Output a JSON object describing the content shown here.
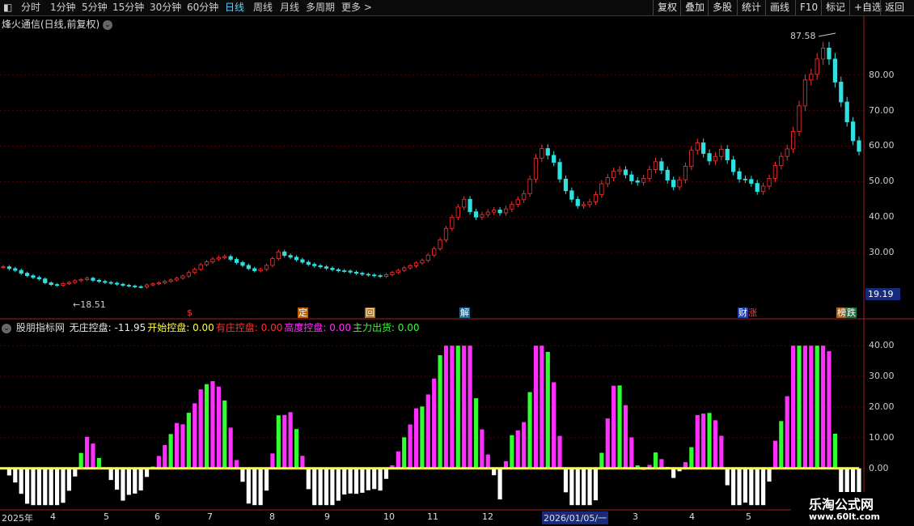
{
  "toolbar": {
    "periods": [
      "分时",
      "1分钟",
      "5分钟",
      "15分钟",
      "30分钟",
      "60分钟",
      "日线",
      "周线",
      "月线",
      "多周期",
      "更多 >"
    ],
    "active": "日线",
    "actions": [
      "复权",
      "叠加",
      "多股",
      "统计",
      "画线",
      "F10",
      "标记",
      "+自选",
      "返回"
    ]
  },
  "main": {
    "title": "烽火通信(日线,前复权)",
    "peak_label": "87.58",
    "low_label": "18.51",
    "current_price": "19.19",
    "y_ticks": [
      "80.00",
      "70.00",
      "60.00",
      "50.00",
      "40.00",
      "30.00"
    ],
    "signals": [
      {
        "text": "$",
        "color": "#ff3030",
        "bg": "transparent"
      },
      {
        "text": "定",
        "color": "#ffffff",
        "bg": "#c06000"
      },
      {
        "text": "回",
        "color": "#ffffff",
        "bg": "#a07030"
      },
      {
        "text": "解",
        "color": "#ffffff",
        "bg": "#1a6a9a"
      },
      {
        "text": "财",
        "color": "#ffffff",
        "bg": "#2040a0"
      },
      {
        "text": "涨",
        "color": "#ff4040",
        "bg": "transparent"
      },
      {
        "text": "榜",
        "color": "#ffffff",
        "bg": "#a06020"
      },
      {
        "text": "跌",
        "color": "#ffffff",
        "bg": "#207040"
      }
    ]
  },
  "indicator": {
    "name": "股朋指标网",
    "items": [
      {
        "label": "无庄控盘: -11.95",
        "color": "#e8e8e8"
      },
      {
        "label": "开始控盘: 0.00",
        "color": "#ffff40"
      },
      {
        "label": "有庄控盘: 0.00",
        "color": "#ff3030"
      },
      {
        "label": "高度控盘: 0.00",
        "color": "#ff30ff"
      },
      {
        "label": "主力出货: 0.00",
        "color": "#30ff30"
      }
    ],
    "y_ticks": [
      "40.00",
      "30.00",
      "20.00",
      "10.00",
      "0.00"
    ]
  },
  "time_axis": [
    "2025年",
    "4",
    "5",
    "6",
    "7",
    "8",
    "9",
    "10",
    "11",
    "12",
    "2026/01/05/一",
    "3",
    "4",
    "5"
  ],
  "watermark": {
    "line1": "乐淘公式网",
    "line2": "www.60lt.com"
  },
  "colors": {
    "up": "#ff3030",
    "down": "#30e0e0",
    "grid": "#5a0000",
    "magenta": "#ff30ff",
    "green": "#30ff30",
    "yellow": "#ffff40",
    "white": "#ffffff"
  },
  "chart_data": {
    "type": "candlestick",
    "close_series": [
      26,
      25.5,
      25,
      24.2,
      23.5,
      23,
      22.6,
      21.5,
      21,
      20.8,
      21.3,
      21.6,
      22.1,
      22.4,
      22.8,
      22.2,
      21.9,
      21.6,
      21.4,
      21.1,
      20.8,
      20.6,
      20.4,
      20.3,
      20.9,
      21.2,
      21.5,
      21.9,
      22.3,
      22.8,
      23.4,
      24.4,
      25.3,
      26.6,
      27.4,
      28.2,
      28.6,
      28.9,
      28.1,
      27.2,
      26.4,
      25.5,
      24.9,
      25.3,
      26.4,
      28.3,
      30.2,
      29.2,
      28.7,
      28,
      27.3,
      26.7,
      26.3,
      26,
      25.6,
      25.2,
      24.9,
      24.8,
      24.5,
      24.2,
      23.9,
      23.7,
      23.5,
      23.3,
      23.8,
      24.4,
      25,
      25.7,
      26.3,
      27.1,
      27.8,
      29.3,
      31.1,
      33.6,
      36.8,
      39.9,
      42.8,
      45,
      41.5,
      40,
      40.7,
      41.4,
      42,
      41.2,
      42.3,
      43.6,
      44.9,
      46.6,
      50.7,
      56.6,
      59.3,
      57.4,
      55.4,
      50.7,
      47.4,
      45,
      43.2,
      43.5,
      44.3,
      46.3,
      49.4,
      51.1,
      52.9,
      53.3,
      51.9,
      50.2,
      49.8,
      50.9,
      53.4,
      55.6,
      53.2,
      50.4,
      48.5,
      50.5,
      54.3,
      58.8,
      60.9,
      57.9,
      55.8,
      57.1,
      59.1,
      56.1,
      52.8,
      50.7,
      50.6,
      49.5,
      47.2,
      48.7,
      50.9,
      54.5,
      57.1,
      59.2,
      64.1,
      71.3,
      78.6,
      80.2,
      84.5,
      87.58,
      84.5,
      78,
      72.4,
      66.8,
      61.5,
      58.5
    ],
    "close_y_range": [
      15,
      92
    ],
    "indicator_bars_y_range": [
      -13,
      44
    ],
    "indicator_y_ticks": [
      40,
      30,
      20,
      10,
      0
    ]
  }
}
